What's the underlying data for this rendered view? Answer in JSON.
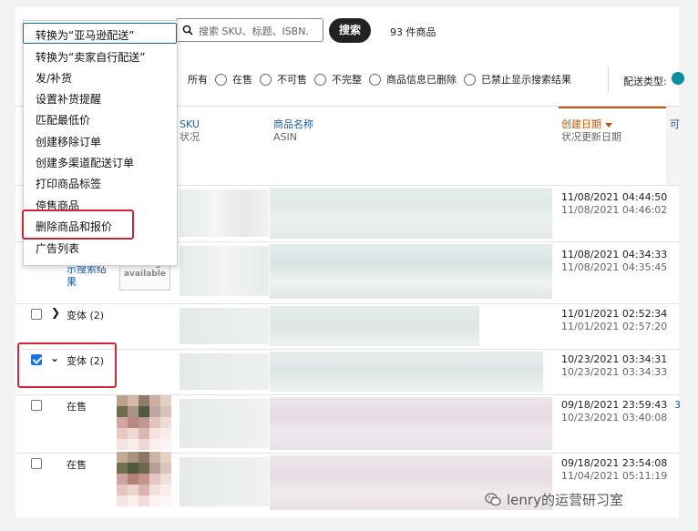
{
  "toolbar": {
    "search_placeholder": "搜索 SKU、标题、ISBN.",
    "search_button": "搜索",
    "product_count": "93 件商品"
  },
  "action_menu": {
    "items": [
      "转换为“亚马逊配送”",
      "转换为“卖家自行配送”",
      "发/补货",
      "设置补货提醒",
      "匹配最低价",
      "创建移除订单",
      "创建多渠道配送订单",
      "打印商品标签",
      "停售商品",
      "删除商品和报价",
      "广告列表"
    ],
    "highlighted_item": "删除商品和报价"
  },
  "filters": {
    "options": [
      "所有",
      "在售",
      "不可售",
      "不完整",
      "商品信息已删除",
      "已禁止显示搜索结果"
    ],
    "shipping_type_label": "配送类型:"
  },
  "table_header": {
    "sku": "SKU",
    "status": "状况",
    "product_name": "商品名称",
    "asin": "ASIN",
    "created_date": "创建日期",
    "status_updated": "状况更新日期",
    "cut_column": "可"
  },
  "rows": [
    {
      "label": "",
      "created": "11/08/2021 04:44:50",
      "updated": "11/08/2021 04:46:02"
    },
    {
      "label": "",
      "created": "11/08/2021 04:34:33",
      "updated": "11/08/2021 04:35:45",
      "status_fragment_1": "示搜索结",
      "status_fragment_2": "果",
      "no_image_1": "No image",
      "no_image_2": "available"
    },
    {
      "label": "变体 (2)",
      "created": "11/01/2021 02:52:34",
      "updated": "11/01/2021 02:57:20"
    },
    {
      "label": "变体 (2)",
      "created": "10/23/2021 03:34:31",
      "updated": "10/23/2021 03:34:33",
      "checked": true
    },
    {
      "label": "在售",
      "created": "09/18/2021 23:59:43",
      "updated": "10/23/2021 03:40:08",
      "extra": "3"
    },
    {
      "label": "在售",
      "created": "09/18/2021 23:54:08",
      "updated": "11/04/2021 05:11:19"
    }
  ],
  "watermark": "lenry的运营研习室",
  "colors": {
    "accent": "#c45500",
    "link": "#1a5fa6",
    "highlight_box": "#d0263a",
    "checkbox": "#1673e6"
  }
}
